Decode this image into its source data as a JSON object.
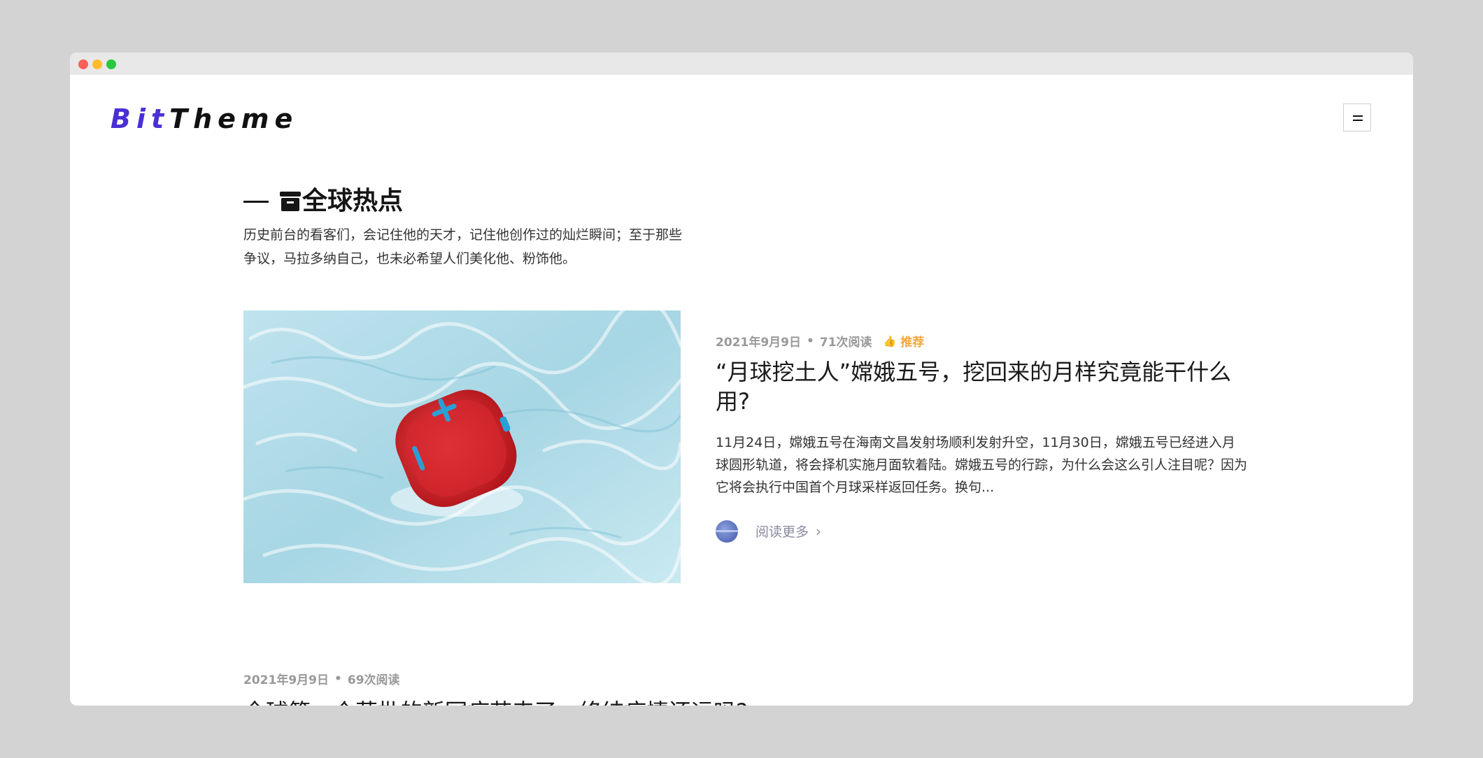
{
  "logo": {
    "part1": "Bit",
    "part2": "Theme"
  },
  "section": {
    "title": "全球热点",
    "description": "历史前台的看客们，会记住他的天才，记住他创作过的灿烂瞬间；至于那些争议，马拉多纳自己，也未必希望人们美化他、粉饰他。"
  },
  "posts": [
    {
      "date": "2021年9月9日",
      "views": "71次阅读",
      "badge": "推荐",
      "title": "“月球挖土人”嫦娥五号，挖回来的月样究竟能干什么用?",
      "excerpt": "11月24日，嫦娥五号在海南文昌发射场顺利发射升空，11月30日，嫦娥五号已经进入月球圆形轨道，将会择机实施月面软着陆。嫦娥五号的行踪，为什么会这么引人注目呢？因为它将会执行中国首个月球采样返回任务。换句...",
      "read_more": "阅读更多"
    },
    {
      "date": "2021年9月9日",
      "views": "69次阅读",
      "title": "全球第一个获批的新冠疫苗来了，终结疫情还远吗?"
    }
  ],
  "colors": {
    "logo_accent": "#4a2fd6",
    "badge": "#f5a640"
  }
}
